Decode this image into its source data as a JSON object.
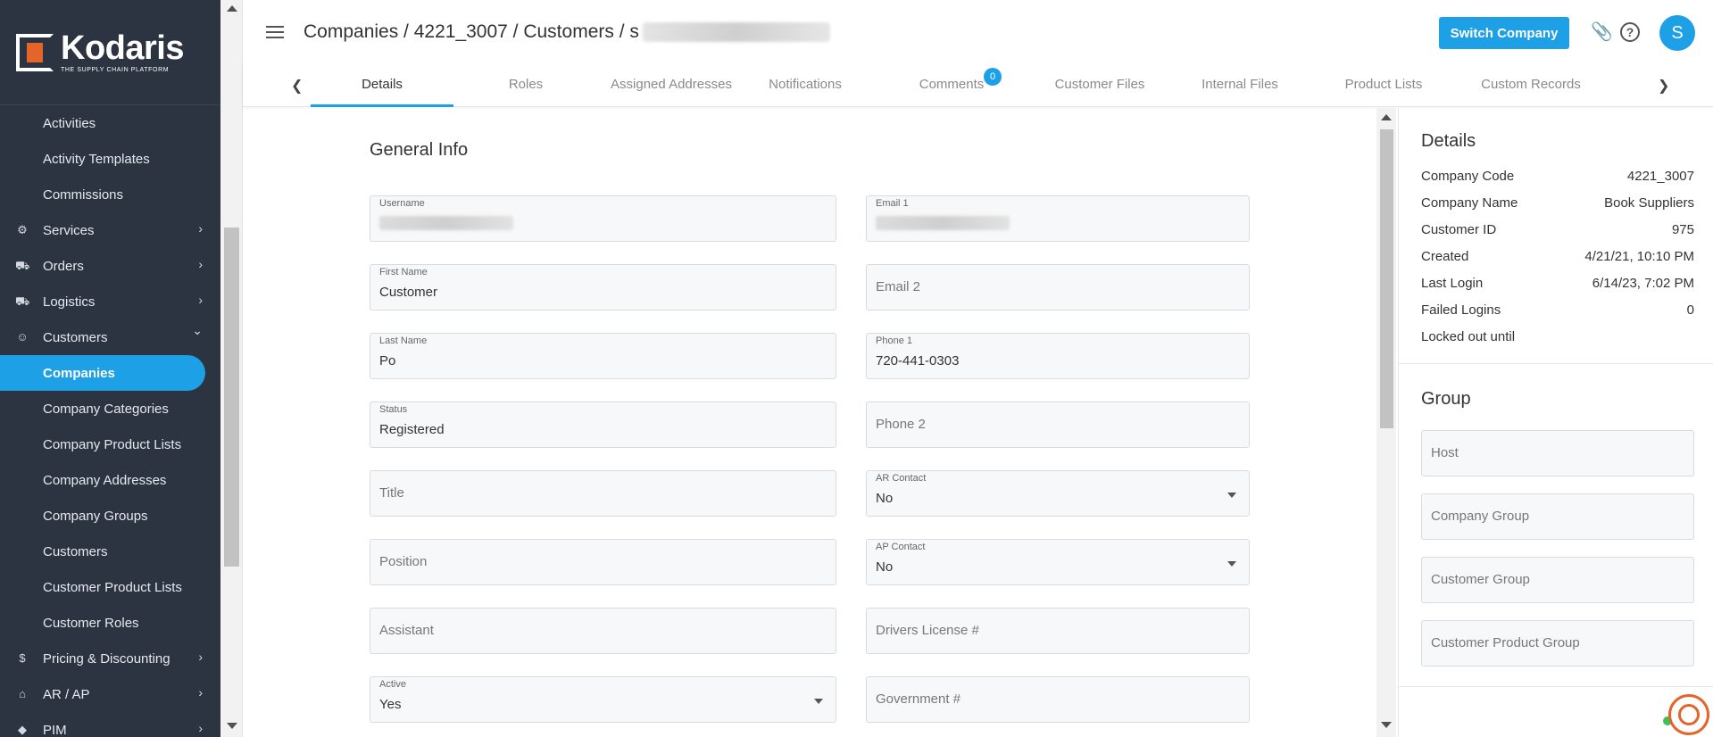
{
  "brand": {
    "name": "Kodaris",
    "tagline": "THE SUPPLY CHAIN PLATFORM",
    "accent": "#1ea0e6",
    "logo_color": "#e5642a"
  },
  "sidebar": {
    "items": [
      {
        "label": "Activities",
        "kind": "sub"
      },
      {
        "label": "Activity Templates",
        "kind": "sub"
      },
      {
        "label": "Commissions",
        "kind": "sub"
      },
      {
        "label": "Services",
        "kind": "top",
        "icon": "gears-icon"
      },
      {
        "label": "Orders",
        "kind": "top",
        "icon": "truck-icon"
      },
      {
        "label": "Logistics",
        "kind": "top",
        "icon": "shipping-icon"
      },
      {
        "label": "Customers",
        "kind": "top",
        "icon": "people-icon",
        "expanded": true
      },
      {
        "label": "Companies",
        "kind": "sub",
        "active": true
      },
      {
        "label": "Company Categories",
        "kind": "sub"
      },
      {
        "label": "Company Product Lists",
        "kind": "sub"
      },
      {
        "label": "Company Addresses",
        "kind": "sub"
      },
      {
        "label": "Company Groups",
        "kind": "sub"
      },
      {
        "label": "Customers",
        "kind": "sub"
      },
      {
        "label": "Customer Product Lists",
        "kind": "sub"
      },
      {
        "label": "Customer Roles",
        "kind": "sub"
      },
      {
        "label": "Pricing & Discounting",
        "kind": "top",
        "icon": "dollar-icon"
      },
      {
        "label": "AR / AP",
        "kind": "top",
        "icon": "bank-icon"
      },
      {
        "label": "PIM",
        "kind": "top",
        "icon": "tag-icon"
      }
    ]
  },
  "header": {
    "breadcrumb": "Companies / 4221_3007 / Customers / s",
    "switch_label": "Switch Company",
    "avatar_initial": "S"
  },
  "tabs": [
    {
      "label": "Details",
      "active": true
    },
    {
      "label": "Roles"
    },
    {
      "label": "Assigned Addresses"
    },
    {
      "label": "Notifications"
    },
    {
      "label": "Comments",
      "badge": "0"
    },
    {
      "label": "Customer Files"
    },
    {
      "label": "Internal Files"
    },
    {
      "label": "Product Lists"
    },
    {
      "label": "Custom Records"
    }
  ],
  "form": {
    "title": "General Info",
    "left": [
      {
        "label": "Username",
        "value": "",
        "blurred": true
      },
      {
        "label": "First Name",
        "value": "Customer"
      },
      {
        "label": "Last Name",
        "value": "Po"
      },
      {
        "label": "Status",
        "value": "Registered"
      },
      {
        "placeholder": "Title"
      },
      {
        "placeholder": "Position"
      },
      {
        "placeholder": "Assistant"
      },
      {
        "label": "Active",
        "value": "Yes",
        "select": true
      }
    ],
    "right": [
      {
        "label": "Email 1",
        "value": "",
        "blurred": true
      },
      {
        "placeholder": "Email 2"
      },
      {
        "label": "Phone 1",
        "value": "720-441-0303"
      },
      {
        "placeholder": "Phone 2"
      },
      {
        "label": "AR Contact",
        "value": "No",
        "select": true
      },
      {
        "label": "AP Contact",
        "value": "No",
        "select": true
      },
      {
        "placeholder": "Drivers License #"
      },
      {
        "placeholder": "Government #"
      }
    ]
  },
  "details": {
    "title": "Details",
    "rows": [
      {
        "k": "Company Code",
        "v": "4221_3007"
      },
      {
        "k": "Company Name",
        "v": "Book Suppliers"
      },
      {
        "k": "Customer ID",
        "v": "975"
      },
      {
        "k": "Created",
        "v": "4/21/21, 10:10 PM"
      },
      {
        "k": "Last Login",
        "v": "6/14/23, 7:02 PM"
      },
      {
        "k": "Failed Logins",
        "v": "0"
      },
      {
        "k": "Locked out until",
        "v": ""
      }
    ]
  },
  "group": {
    "title": "Group",
    "fields": [
      "Host",
      "Company Group",
      "Customer Group",
      "Customer Product Group"
    ]
  }
}
